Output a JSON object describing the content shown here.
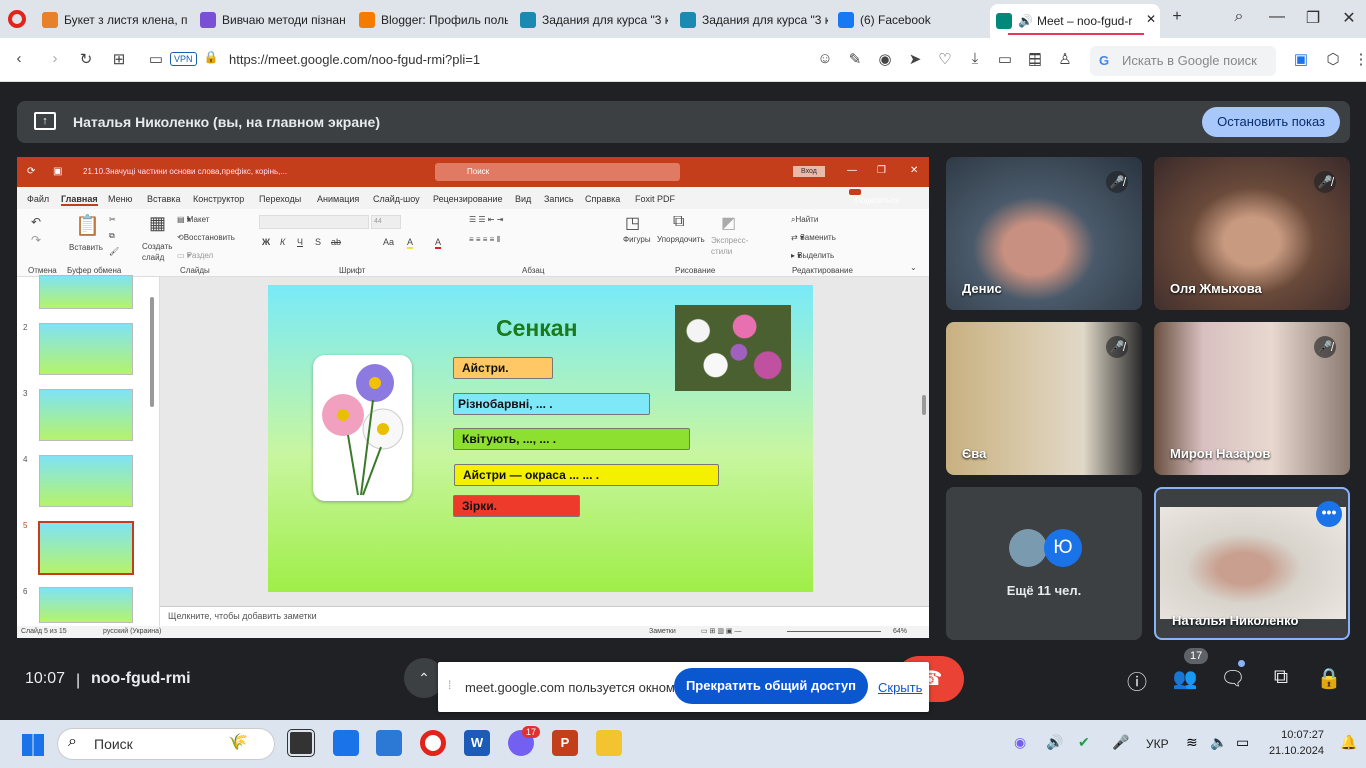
{
  "browser": {
    "tabs": [
      {
        "label": "Букет з листя клена, пор",
        "color": "#e8822a"
      },
      {
        "label": "Вивчаю методи пізнанн",
        "color": "#7a4fd6"
      },
      {
        "label": "Blogger: Профиль поль",
        "color": "#f57c00"
      },
      {
        "label": "Задания для курса \"3 кл",
        "color": "#1a8ab3"
      },
      {
        "label": "Задания для курса \"3 кл",
        "color": "#1a8ab3"
      },
      {
        "label": "(6) Facebook",
        "color": "#1877f2"
      },
      {
        "label": "Meet – noo-fgud-r",
        "color": "#00897b"
      }
    ],
    "vpn": "VPN",
    "url": "https://meet.google.com/noo-fgud-rmi?pli=1",
    "search_placeholder": "Искать в Google поиск"
  },
  "meet": {
    "presenter_banner": "Наталья Николенко (вы, на главном экране)",
    "stop_presentation": "Остановить показ",
    "time": "10:07",
    "meeting_code": "noo-fgud-rmi",
    "participant_count": "17",
    "participants": [
      {
        "name": "Денис",
        "muted": true
      },
      {
        "name": "Оля Жмыхова",
        "muted": true
      },
      {
        "name": "Єва",
        "muted": true
      },
      {
        "name": "Мирон Назаров",
        "muted": true
      },
      {
        "name": "Ещё 11 чел.",
        "avatar_letter": "Ю"
      },
      {
        "name": "Наталья Николенко"
      }
    ],
    "share_popup": {
      "text": "meet.google.com пользуется окном.",
      "stop": "Прекратить общий доступ",
      "hide": "Скрыть"
    }
  },
  "ppt": {
    "title": "21.10.Значущі частини основи слова,префікс, корінь,...",
    "search": "Поиск",
    "login": "Вход",
    "share": "Поделиться",
    "menu": [
      "Файл",
      "Главная",
      "Меню",
      "Вставка",
      "Конструктор",
      "Переходы",
      "Анимация",
      "Слайд-шоу",
      "Рецензирование",
      "Вид",
      "Запись",
      "Справка",
      "Foxit PDF"
    ],
    "ribbon": {
      "undo": "Отмена",
      "paste": "Вставить",
      "clipboard": "Буфер обмена",
      "create_slide": "Создать слайд",
      "layout": "Макет",
      "reset": "Восстановить",
      "section": "Раздел",
      "slides": "Слайды",
      "font": "Шрифт",
      "font_size": "44",
      "paragraph": "Абзац",
      "shapes": "Фигуры",
      "arrange": "Упорядочить",
      "express_styles": "Экспресс-стили",
      "drawing": "Рисование",
      "find": "Найти",
      "replace": "Заменить",
      "select": "Выделить",
      "editing": "Редактирование",
      "font_buttons": [
        "Ж",
        "К",
        "Ч",
        "S",
        "ab",
        "Aa",
        "A",
        "A"
      ]
    },
    "thumbs": [
      "2",
      "3",
      "4",
      "5",
      "6"
    ],
    "slide": {
      "title": "Сенкан",
      "items": [
        {
          "text": "Айстри.",
          "color": "#ffc864"
        },
        {
          "text": "Різнобарвні, ... .",
          "color": "#7ee8f8"
        },
        {
          "text": "Квітують, ..., ... .",
          "color": "#8ee030"
        },
        {
          "text": "Айстри — окраса ... ... .",
          "color": "#f4f000"
        },
        {
          "text": "Зірки.",
          "color": "#ee3a2a"
        }
      ]
    },
    "notes": "Щелкните, чтобы добавить заметки",
    "status": {
      "slide": "Слайд 5 из 15",
      "lang": "русский (Украина)",
      "notes": "Заметки",
      "zoom": "64%"
    }
  },
  "taskbar": {
    "search": "Поиск",
    "lang": "УКР",
    "time": "10:07:27",
    "date": "21.10.2024",
    "viber_badge": "17"
  }
}
